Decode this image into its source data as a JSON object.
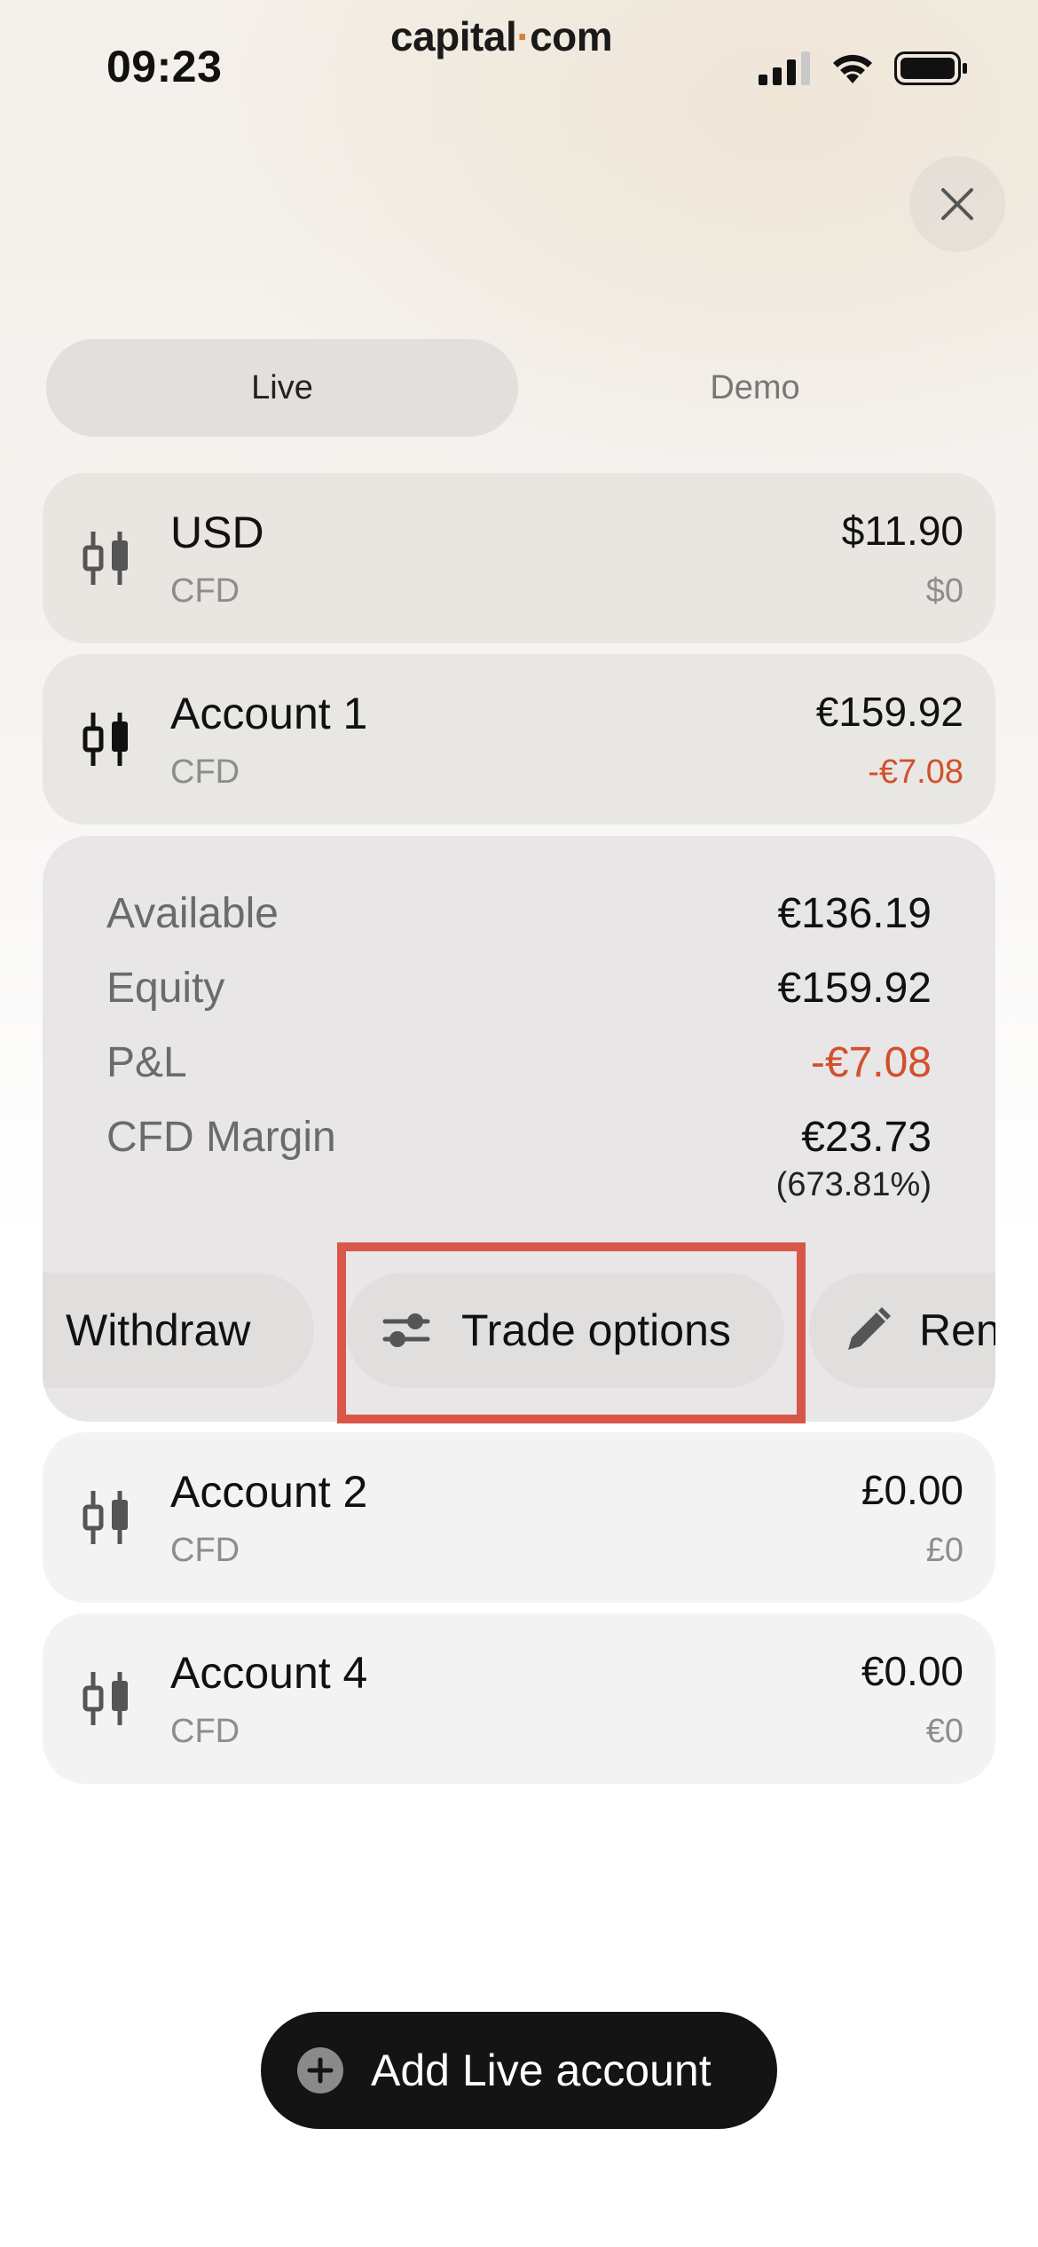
{
  "status_bar": {
    "time": "09:23"
  },
  "brand": {
    "left": "capital",
    "dot": "·",
    "right": "com"
  },
  "tabs": {
    "live": "Live",
    "demo": "Demo"
  },
  "accounts": [
    {
      "name": "USD",
      "type": "CFD",
      "balance": "$11.90",
      "pnl": "$0"
    },
    {
      "name": "Account 1",
      "type": "CFD",
      "balance": "€159.92",
      "pnl": "-€7.08"
    },
    {
      "name": "Account 2",
      "type": "CFD",
      "balance": "£0.00",
      "pnl": "£0"
    },
    {
      "name": "Account 4",
      "type": "CFD",
      "balance": "€0.00",
      "pnl": "€0"
    }
  ],
  "details": {
    "available_label": "Available",
    "available_value": "€136.19",
    "equity_label": "Equity",
    "equity_value": "€159.92",
    "pnl_label": "P&L",
    "pnl_value": "-€7.08",
    "margin_label": "CFD Margin",
    "margin_value": "€23.73",
    "margin_pct": "(673.81%)"
  },
  "actions": {
    "withdraw": "Withdraw",
    "trade_options": "Trade options",
    "rename": "Ren"
  },
  "add_button": {
    "label": "Add Live account"
  },
  "colors": {
    "negative": "#d2502c",
    "highlight": "#d9574a",
    "accent": "#d9812f"
  }
}
